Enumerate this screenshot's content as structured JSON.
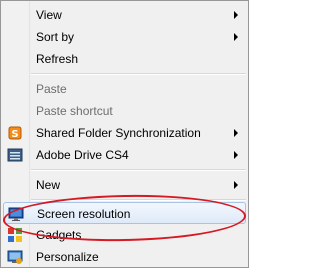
{
  "menu": {
    "items": [
      {
        "label": "View",
        "arrow": true,
        "disabled": false
      },
      {
        "label": "Sort by",
        "arrow": true,
        "disabled": false
      },
      {
        "label": "Refresh",
        "arrow": false,
        "disabled": false
      },
      {
        "label": "Paste",
        "arrow": false,
        "disabled": true
      },
      {
        "label": "Paste shortcut",
        "arrow": false,
        "disabled": true
      },
      {
        "label": "Shared Folder Synchronization",
        "arrow": true,
        "disabled": false,
        "icon": "shared-folder-sync-icon"
      },
      {
        "label": "Adobe Drive CS4",
        "arrow": true,
        "disabled": false,
        "icon": "adobe-drive-icon"
      },
      {
        "label": "New",
        "arrow": true,
        "disabled": false
      },
      {
        "label": "Screen resolution",
        "arrow": false,
        "disabled": false,
        "highlighted": true,
        "icon": "screen-resolution-icon"
      },
      {
        "label": "Gadgets",
        "arrow": false,
        "disabled": false,
        "icon": "gadgets-icon"
      },
      {
        "label": "Personalize",
        "arrow": false,
        "disabled": false,
        "icon": "personalize-icon"
      }
    ]
  },
  "annotation": {
    "shape": "ellipse",
    "color": "#d51a24"
  }
}
